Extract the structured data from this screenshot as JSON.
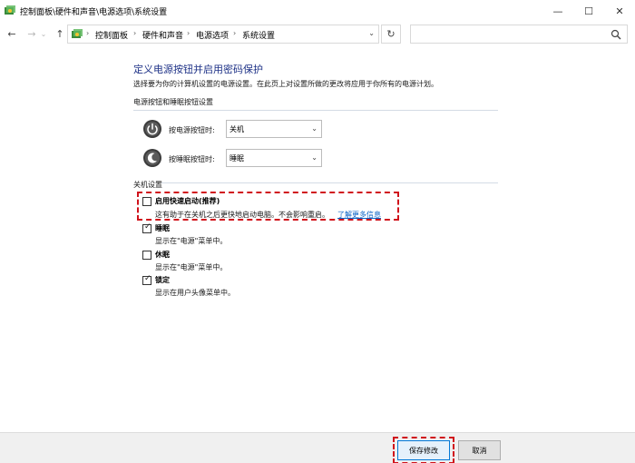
{
  "window": {
    "title": "控制面板\\硬件和声音\\电源选项\\系统设置",
    "minimize": "—",
    "maximize": "☐",
    "close": "✕"
  },
  "nav": {
    "back": "←",
    "forward": "→",
    "recent": "⌄",
    "up": "↑",
    "breadcrumb": [
      "控制面板",
      "硬件和声音",
      "电源选项",
      "系统设置"
    ],
    "breadcrumb_sep": "›",
    "dropdown": "⌄",
    "refresh": "↻",
    "search_placeholder": ""
  },
  "page": {
    "title": "定义电源按钮并启用密码保护",
    "description": "选择要为你的计算机设置的电源设置。在此页上对设置所做的更改将应用于你所有的电源计划。"
  },
  "power_section": {
    "label": "电源按钮和睡眠按钮设置",
    "power_button": {
      "label": "按电源按钮时:",
      "value": "关机"
    },
    "sleep_button": {
      "label": "按睡眠按钮时:",
      "value": "睡眠"
    },
    "select_arrow": "⌄"
  },
  "shutdown_section": {
    "label": "关机设置",
    "options": [
      {
        "label": "启用快速启动(推荐)",
        "checked": false,
        "description": "这有助于在关机之后更快地启动电脑。不会影响重启。",
        "link": "了解更多信息"
      },
      {
        "label": "睡眠",
        "checked": true,
        "description": "显示在\"电源\"菜单中。"
      },
      {
        "label": "休眠",
        "checked": false,
        "description": "显示在\"电源\"菜单中。"
      },
      {
        "label": "锁定",
        "checked": true,
        "description": "显示在用户头像菜单中。"
      }
    ],
    "check_mark": "✓"
  },
  "footer": {
    "save_label": "保存修改",
    "cancel_label": "取消"
  },
  "colors": {
    "title_blue": "#1e3287",
    "link_blue": "#0b63c5",
    "highlight_red": "#d0121b"
  }
}
